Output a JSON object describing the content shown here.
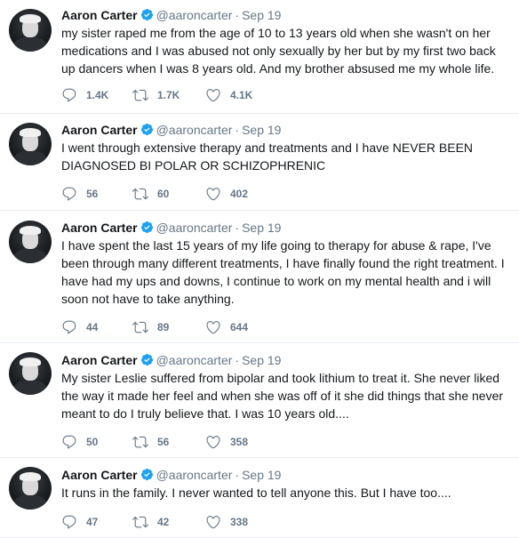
{
  "tweets": [
    {
      "author": "Aaron Carter",
      "handle": "@aaroncarter",
      "separator": "·",
      "date": "Sep 19",
      "text": "my sister raped me from the age of 10 to 13 years old when she wasn't on her medications and I was abused not only sexually by her but by my first two back up dancers when I was 8 years old. And my brother absused me my whole life.",
      "replies": "1.4K",
      "retweets": "1.7K",
      "likes": "4.1K"
    },
    {
      "author": "Aaron Carter",
      "handle": "@aaroncarter",
      "separator": "·",
      "date": "Sep 19",
      "text": "I went through extensive therapy and treatments and I have NEVER BEEN DIAGNOSED BI POLAR OR SCHIZOPHRENIC",
      "replies": "56",
      "retweets": "60",
      "likes": "402"
    },
    {
      "author": "Aaron Carter",
      "handle": "@aaroncarter",
      "separator": "·",
      "date": "Sep 19",
      "text": "I have spent the last 15 years of my life going to therapy for abuse & rape, I've been through many different treatments, I have finally found the right treatment. I have had my ups and downs, I continue to work on my mental health and i will soon not have to take anything.",
      "replies": "44",
      "retweets": "89",
      "likes": "644"
    },
    {
      "author": "Aaron Carter",
      "handle": "@aaroncarter",
      "separator": "·",
      "date": "Sep 19",
      "text": "My sister Leslie suffered from bipolar and took lithium to treat it. She never liked the way it made her feel and when she was off of it she did things that she never meant to do I truly believe that. I was 10 years old....",
      "replies": "50",
      "retweets": "56",
      "likes": "358"
    },
    {
      "author": "Aaron Carter",
      "handle": "@aaroncarter",
      "separator": "·",
      "date": "Sep 19",
      "text": "It runs in the family. I never wanted to tell anyone this. But I have too....",
      "replies": "47",
      "retweets": "42",
      "likes": "338"
    }
  ],
  "icons": {
    "reply": "reply-icon",
    "retweet": "retweet-icon",
    "like": "like-icon",
    "verified": "verified-badge-icon"
  },
  "colors": {
    "text": "#14171a",
    "secondary": "#657786",
    "verified": "#1da1f2",
    "divider": "#e6ecf0"
  }
}
